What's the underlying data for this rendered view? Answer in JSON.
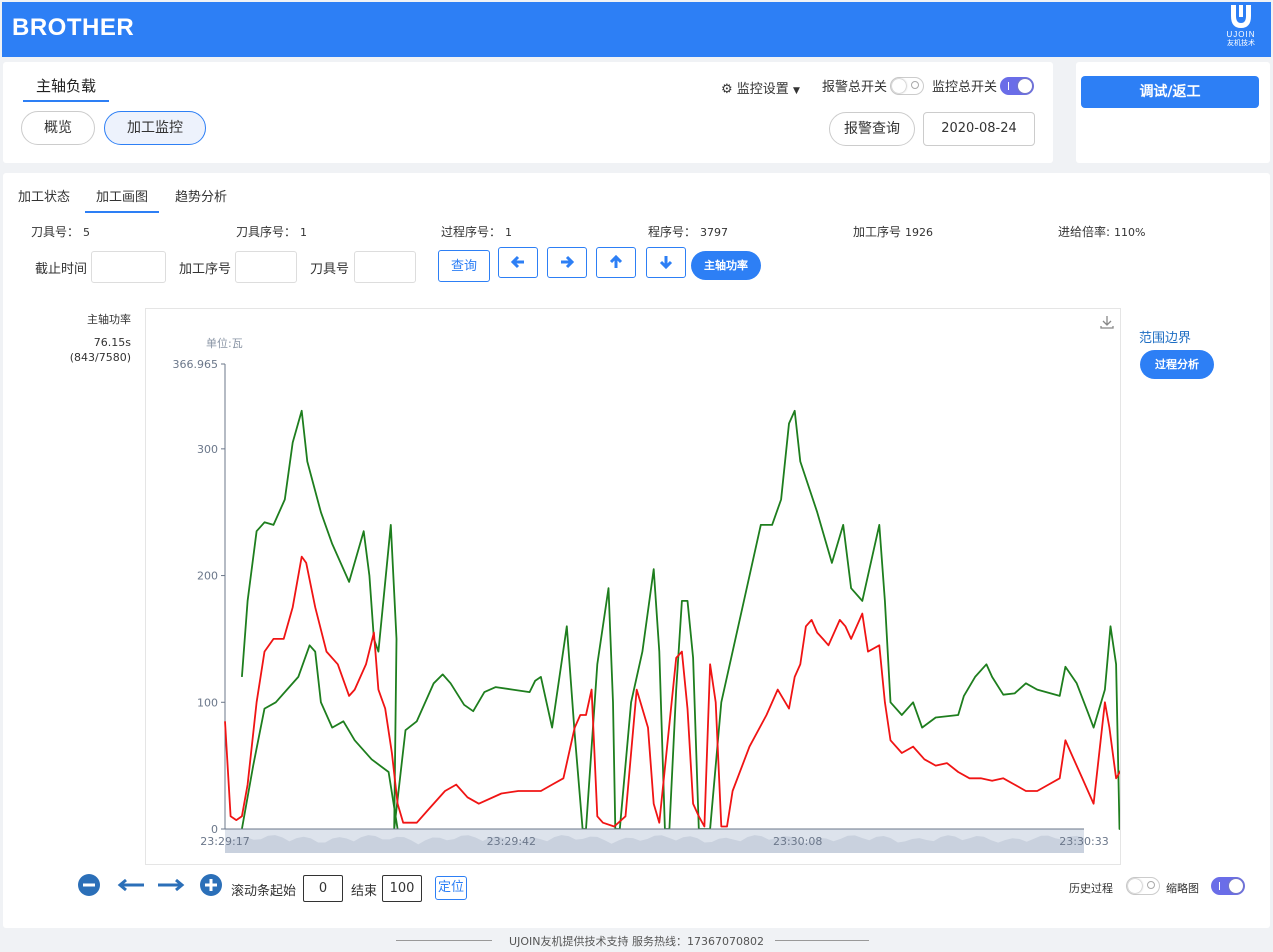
{
  "header": {
    "brand": "BROTHER",
    "logo_text": "UJOIN",
    "logo_subtext": "友机技术"
  },
  "top": {
    "page_title": "主轴负载",
    "view_buttons": [
      "概览",
      "加工监控"
    ],
    "monitor_settings": "监控设置",
    "alarm_switch_label": "报警总开关",
    "monitor_switch_label": "监控总开关",
    "alarm_query": "报警查询",
    "date": "2020-08-24",
    "debug_button": "调试/返工"
  },
  "tabs": [
    "加工状态",
    "加工画图",
    "趋势分析"
  ],
  "info": {
    "tool_no_label": "刀具号：",
    "tool_no": "5",
    "tool_seq_label": "刀具序号：",
    "tool_seq": "1",
    "proc_seq_label": "过程序号：",
    "proc_seq": "1",
    "prog_no_label": "程序号：",
    "prog_no": "3797",
    "machining_no_label": "加工序号",
    "machining_no": "1926",
    "feed_rate_label": "进给倍率:",
    "feed_rate": "110%"
  },
  "filters": {
    "cutoff_label": "截止时间",
    "machining_label": "加工序号",
    "tool_label": "刀具号",
    "query_button": "查询",
    "spindle_power_button": "主轴功率"
  },
  "side_info": {
    "title": "主轴功率",
    "time": "76.15s",
    "count": "(843/7580)"
  },
  "range_link": "范围边界",
  "process_button": "过程分析",
  "controls": {
    "scroll_start_label": "滚动条起始",
    "scroll_start": "0",
    "end_label": "结束",
    "end": "100",
    "locate_button": "定位",
    "history_label": "历史过程",
    "thumbnail_label": "缩略图"
  },
  "footer": "UJOIN友机提供技术支持 服务热线：17367070802",
  "colors": {
    "primary": "#2d7ff5",
    "green": "#1e7e1e",
    "red": "#f01414"
  },
  "chart_data": {
    "type": "line",
    "unit_label": "单位:瓦",
    "ylim": [
      0,
      366.965
    ],
    "y_ticks": [
      "366.965",
      "300",
      "200",
      "100",
      "0"
    ],
    "x_ticks": [
      "23:29:17",
      "23:29:42",
      "23:30:08",
      "23:30:33"
    ],
    "legend": "none",
    "series": [
      {
        "color": "#1e7e1e",
        "points": [
          [
            1.5,
            120
          ],
          [
            2,
            180
          ],
          [
            2.8,
            235
          ],
          [
            3.5,
            242
          ],
          [
            4.3,
            240
          ],
          [
            5.3,
            260
          ],
          [
            6,
            305
          ],
          [
            6.8,
            330
          ],
          [
            7.3,
            290
          ],
          [
            8.5,
            250
          ],
          [
            9.5,
            225
          ],
          [
            11,
            195
          ],
          [
            12.3,
            235
          ],
          [
            12.8,
            200
          ],
          [
            13.2,
            150
          ],
          [
            13.6,
            140
          ],
          [
            14.7,
            240
          ],
          [
            15.2,
            150
          ],
          [
            15,
            0
          ],
          [
            16,
            78
          ],
          [
            17,
            85
          ],
          [
            18.5,
            115
          ],
          [
            19.3,
            122
          ],
          [
            20,
            115
          ],
          [
            21.2,
            98
          ],
          [
            22,
            93
          ],
          [
            23,
            108
          ],
          [
            24,
            112
          ],
          [
            25.5,
            110
          ],
          [
            27,
            108
          ],
          [
            27.5,
            117
          ],
          [
            28,
            120
          ],
          [
            28.5,
            100
          ],
          [
            29,
            80
          ],
          [
            30.3,
            160
          ],
          [
            31,
            75
          ],
          [
            31.7,
            0
          ],
          [
            32,
            0
          ],
          [
            33,
            130
          ],
          [
            34,
            190
          ],
          [
            34.4,
            100
          ],
          [
            34.6,
            0
          ],
          [
            35,
            0
          ],
          [
            36,
            100
          ],
          [
            37,
            140
          ],
          [
            38,
            205
          ],
          [
            38.5,
            140
          ],
          [
            39,
            0
          ],
          [
            39.4,
            0
          ],
          [
            40,
            110
          ],
          [
            40.5,
            180
          ],
          [
            41,
            180
          ],
          [
            41.5,
            135
          ],
          [
            42,
            0
          ],
          [
            43,
            0
          ],
          [
            44,
            100
          ],
          [
            46,
            180
          ],
          [
            47.5,
            240
          ],
          [
            48.5,
            240
          ],
          [
            49.3,
            260
          ],
          [
            50,
            320
          ],
          [
            50.5,
            330
          ],
          [
            51,
            290
          ],
          [
            52.5,
            250
          ],
          [
            53.8,
            210
          ],
          [
            54.8,
            240
          ],
          [
            55.5,
            190
          ],
          [
            56.5,
            180
          ],
          [
            58,
            240
          ],
          [
            58.5,
            180
          ],
          [
            59,
            100
          ],
          [
            60,
            90
          ],
          [
            61,
            100
          ],
          [
            61.8,
            80
          ],
          [
            63,
            88
          ],
          [
            65,
            90
          ],
          [
            65.5,
            105
          ],
          [
            66.5,
            120
          ],
          [
            67.5,
            130
          ],
          [
            68,
            120
          ],
          [
            69,
            106
          ],
          [
            70,
            107
          ],
          [
            71,
            115
          ],
          [
            72,
            110
          ],
          [
            74,
            105
          ],
          [
            74.5,
            128
          ],
          [
            75.5,
            115
          ],
          [
            76.5,
            92
          ],
          [
            77,
            80
          ],
          [
            78,
            110
          ],
          [
            78.5,
            160
          ],
          [
            79,
            130
          ],
          [
            79.3,
            0
          ],
          [
            80,
            0
          ],
          [
            81,
            80
          ],
          [
            82.5,
            190
          ],
          [
            83,
            100
          ],
          [
            83.4,
            0
          ],
          [
            84,
            0
          ],
          [
            85,
            170
          ],
          [
            85.3,
            100
          ],
          [
            85.5,
            0
          ],
          [
            86,
            0
          ],
          [
            86.3,
            60
          ],
          [
            87,
            110
          ],
          [
            88,
            120
          ],
          [
            89,
            115
          ],
          [
            90,
            205
          ],
          [
            90.5,
            150
          ],
          [
            91,
            0
          ],
          [
            91.5,
            60
          ],
          [
            92.5,
            0
          ],
          [
            93,
            195
          ],
          [
            93.4,
            95
          ],
          [
            93.5,
            0
          ]
        ]
      },
      {
        "color": "#f01414",
        "points": [
          [
            0,
            85
          ],
          [
            0.5,
            10
          ],
          [
            1,
            7
          ],
          [
            1.5,
            10
          ],
          [
            2,
            35
          ],
          [
            2.8,
            100
          ],
          [
            3.5,
            140
          ],
          [
            4.3,
            150
          ],
          [
            5.2,
            150
          ],
          [
            6,
            175
          ],
          [
            6.8,
            215
          ],
          [
            7.2,
            210
          ],
          [
            8,
            175
          ],
          [
            9,
            140
          ],
          [
            10,
            130
          ],
          [
            11,
            105
          ],
          [
            11.5,
            110
          ],
          [
            12.5,
            130
          ],
          [
            13.2,
            155
          ],
          [
            13.6,
            110
          ],
          [
            14.2,
            95
          ],
          [
            14.8,
            60
          ],
          [
            15.3,
            20
          ],
          [
            15.8,
            5
          ],
          [
            17,
            5
          ],
          [
            18,
            15
          ],
          [
            19.5,
            30
          ],
          [
            20.5,
            35
          ],
          [
            21.5,
            25
          ],
          [
            22.5,
            20
          ],
          [
            24.5,
            28
          ],
          [
            26,
            30
          ],
          [
            28,
            30
          ],
          [
            29,
            35
          ],
          [
            30,
            40
          ],
          [
            31,
            80
          ],
          [
            31.5,
            90
          ],
          [
            32,
            90
          ],
          [
            32.5,
            110
          ],
          [
            33,
            10
          ],
          [
            33.5,
            5
          ],
          [
            34.5,
            2
          ],
          [
            35.5,
            10
          ],
          [
            36.5,
            110
          ],
          [
            37.5,
            80
          ],
          [
            38,
            20
          ],
          [
            38.5,
            5
          ],
          [
            40,
            135
          ],
          [
            40.5,
            140
          ],
          [
            41,
            95
          ],
          [
            41.5,
            20
          ],
          [
            42,
            10
          ],
          [
            42.5,
            2
          ],
          [
            43,
            130
          ],
          [
            43.5,
            100
          ],
          [
            44,
            2
          ],
          [
            44.5,
            2
          ],
          [
            45,
            30
          ],
          [
            46.5,
            65
          ],
          [
            48,
            90
          ],
          [
            49,
            110
          ],
          [
            50,
            95
          ],
          [
            50.5,
            120
          ],
          [
            51,
            130
          ],
          [
            51.5,
            160
          ],
          [
            52,
            165
          ],
          [
            52.5,
            155
          ],
          [
            53,
            150
          ],
          [
            53.5,
            145
          ],
          [
            54.5,
            165
          ],
          [
            55,
            160
          ],
          [
            55.5,
            150
          ],
          [
            56.5,
            170
          ],
          [
            57,
            140
          ],
          [
            58,
            145
          ],
          [
            58.5,
            100
          ],
          [
            59,
            70
          ],
          [
            60,
            60
          ],
          [
            61,
            65
          ],
          [
            62,
            55
          ],
          [
            63,
            50
          ],
          [
            64,
            52
          ],
          [
            65,
            45
          ],
          [
            66,
            40
          ],
          [
            67,
            40
          ],
          [
            68,
            38
          ],
          [
            69,
            40
          ],
          [
            70,
            35
          ],
          [
            71,
            30
          ],
          [
            72,
            30
          ],
          [
            73,
            35
          ],
          [
            74,
            40
          ],
          [
            74.5,
            70
          ],
          [
            75,
            60
          ],
          [
            76,
            40
          ],
          [
            77,
            20
          ],
          [
            78,
            100
          ],
          [
            78.4,
            80
          ],
          [
            79,
            40
          ],
          [
            80,
            55
          ],
          [
            81,
            90
          ],
          [
            81.5,
            70
          ],
          [
            82,
            40
          ],
          [
            83,
            140
          ],
          [
            83.5,
            135
          ],
          [
            84,
            20
          ],
          [
            84.5,
            10
          ],
          [
            85,
            20
          ],
          [
            86,
            120
          ],
          [
            86.5,
            115
          ],
          [
            87,
            110
          ],
          [
            87.5,
            20
          ],
          [
            88,
            10
          ],
          [
            88.4,
            90
          ],
          [
            88.7,
            10
          ],
          [
            89.2,
            0
          ]
        ]
      },
      {
        "color": "#1e7e1e",
        "points": [
          [
            1.5,
            0
          ],
          [
            2.5,
            50
          ],
          [
            3.5,
            95
          ],
          [
            4.5,
            100
          ],
          [
            5.5,
            110
          ],
          [
            6.5,
            120
          ],
          [
            7.5,
            145
          ],
          [
            8,
            140
          ],
          [
            8.5,
            100
          ],
          [
            9.5,
            80
          ],
          [
            10.5,
            85
          ],
          [
            11.5,
            70
          ],
          [
            13,
            55
          ],
          [
            14.5,
            45
          ],
          [
            15.3,
            0
          ]
        ]
      }
    ]
  }
}
